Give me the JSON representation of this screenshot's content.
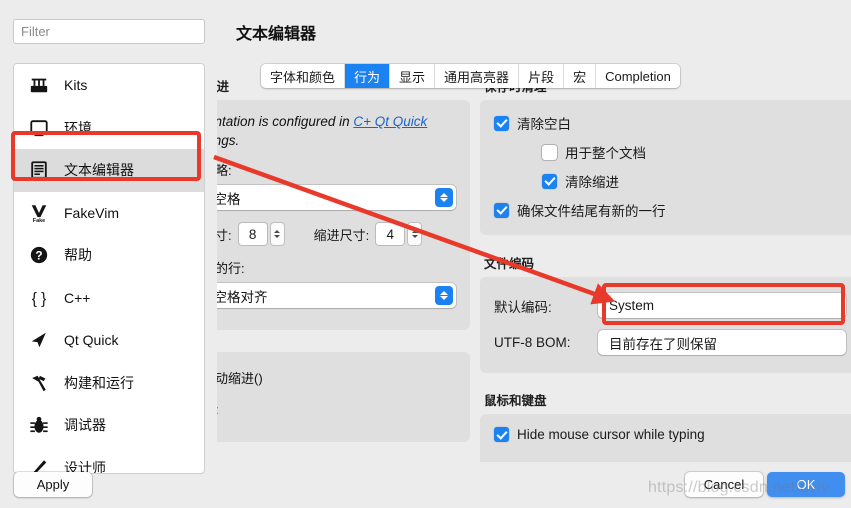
{
  "window": {
    "title": "文本编辑器"
  },
  "sidebar": {
    "filter_placeholder": "Filter",
    "filter_value": "",
    "items": [
      {
        "label": "Kits",
        "icon": "kits-icon",
        "selected": false
      },
      {
        "label": "环境",
        "icon": "monitor-icon",
        "selected": false
      },
      {
        "label": "文本编辑器",
        "icon": "text-editor-icon",
        "selected": true
      },
      {
        "label": "FakeVim",
        "icon": "fakevim-icon",
        "selected": false
      },
      {
        "label": "帮助",
        "icon": "help-icon",
        "selected": false
      },
      {
        "label": "C++",
        "icon": "braces-icon",
        "selected": false
      },
      {
        "label": "Qt Quick",
        "icon": "qtquick-icon",
        "selected": false
      },
      {
        "label": "构建和运行",
        "icon": "hammer-icon",
        "selected": false
      },
      {
        "label": "调试器",
        "icon": "bug-icon",
        "selected": false
      },
      {
        "label": "设计师",
        "icon": "pencil-icon",
        "selected": false
      }
    ]
  },
  "tabs": [
    {
      "label": "字体和颜色",
      "active": false
    },
    {
      "label": "行为",
      "active": true
    },
    {
      "label": "显示",
      "active": false
    },
    {
      "label": "通用高亮器",
      "active": false
    },
    {
      "label": "片段",
      "active": false
    },
    {
      "label": "宏",
      "active": false
    },
    {
      "label": "Completion",
      "active": false
    }
  ],
  "indentation": {
    "group_title": "自动缩进",
    "note_prefix": "indentation is configured in ",
    "note_link1": "C+",
    "note_mid": " Qt Quick",
    "note_suffix": " settings.",
    "tab_policy_label": "符策略:",
    "tab_policy_value": "仅空格",
    "tab_size_label": "符尺寸:",
    "tab_size_value": "8",
    "indent_size_label": "缩进尺寸:",
    "indent_size_value": "4",
    "continuation_label": "连续的行:",
    "continuation_value": "用空格对齐"
  },
  "auto_indent": {
    "checkbox_label": "启自动缩进()",
    "field_label": "缩进:"
  },
  "cleanup": {
    "group_title": "保存时清理",
    "items": [
      {
        "label": "清除空白",
        "checked": true,
        "indent": 0
      },
      {
        "label": "用于整个文档",
        "checked": false,
        "indent": 1
      },
      {
        "label": "清除缩进",
        "checked": true,
        "indent": 1
      },
      {
        "label": "确保文件结尾有新的一行",
        "checked": true,
        "indent": 0
      }
    ]
  },
  "encoding": {
    "group_title": "文件编码",
    "default_label": "默认编码:",
    "default_value": "System",
    "bom_label": "UTF-8 BOM:",
    "bom_value": "目前存在了则保留"
  },
  "mouse_keyboard": {
    "group_title": "鼠标和键盘",
    "items": [
      {
        "label": "Hide mouse cursor while typing",
        "checked": true
      }
    ]
  },
  "buttons": {
    "apply": "Apply",
    "cancel": "Cancel",
    "ok": "OK"
  },
  "annotations": {
    "accent_color": "#e8392b",
    "watermark": "https://blog.csdn.net/dviv"
  }
}
